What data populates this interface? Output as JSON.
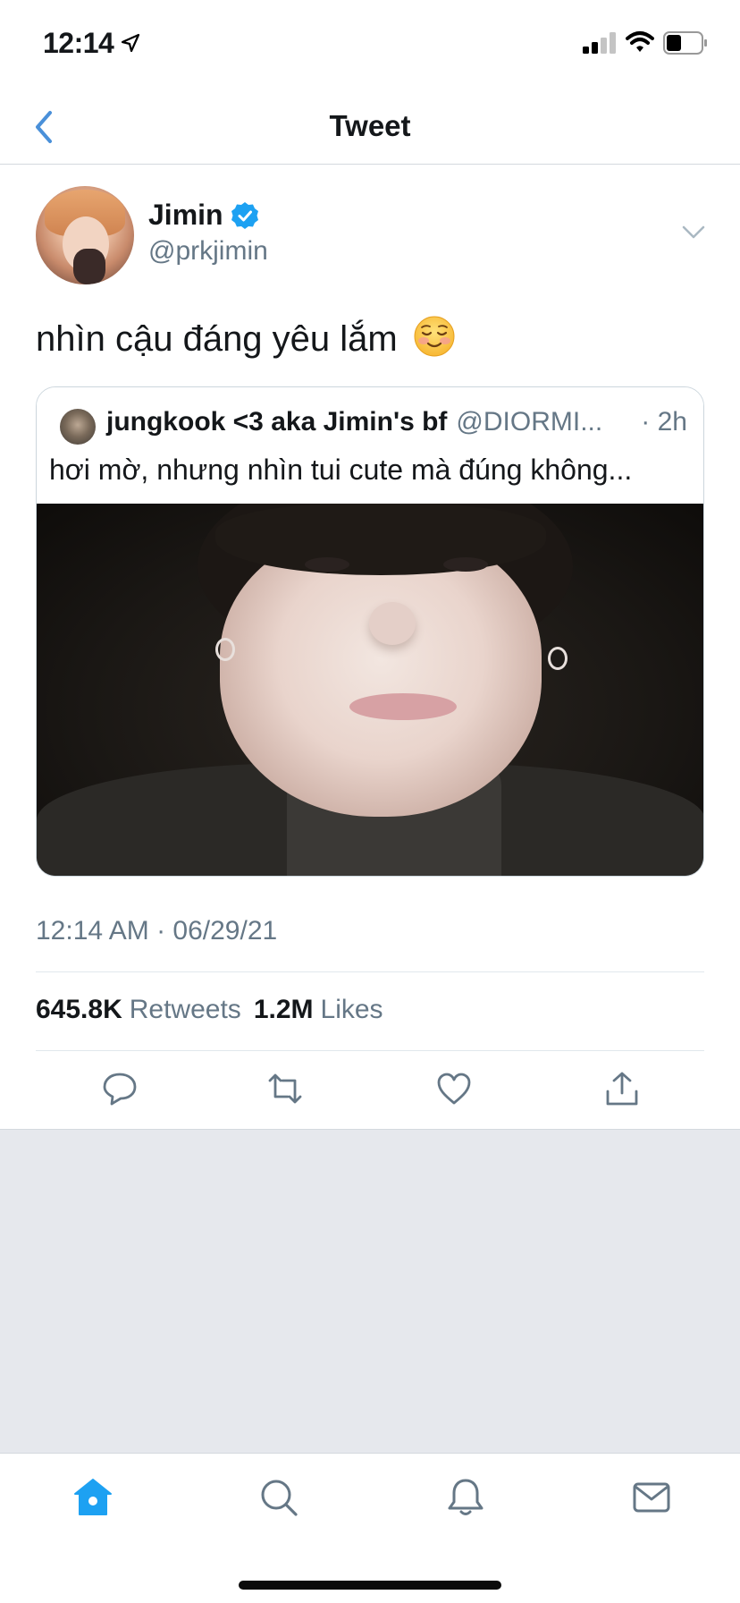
{
  "status_bar": {
    "time": "12:14"
  },
  "nav": {
    "title": "Tweet"
  },
  "tweet": {
    "author": {
      "display_name": "Jimin",
      "handle": "@prkjimin",
      "verified": true
    },
    "text": "nhìn cậu đáng yêu lắm",
    "emoji": "smiling-face-icon",
    "timestamp": "12:14 AM · 06/29/21",
    "stats": {
      "retweets_count": "645.8K",
      "retweets_label": "Retweets",
      "likes_count": "1.2M",
      "likes_label": "Likes"
    }
  },
  "quoted_tweet": {
    "author_name": "jungkook <3 aka Jimin's bf",
    "handle": "@DIORMI...",
    "time": "· 2h",
    "text": "hơi mờ, nhưng nhìn tui cute mà đúng không..."
  },
  "colors": {
    "accent": "#1da1f2",
    "nav_accent": "#4a90d9",
    "secondary_text": "#657786",
    "gray_background": "#e6e8ed"
  }
}
